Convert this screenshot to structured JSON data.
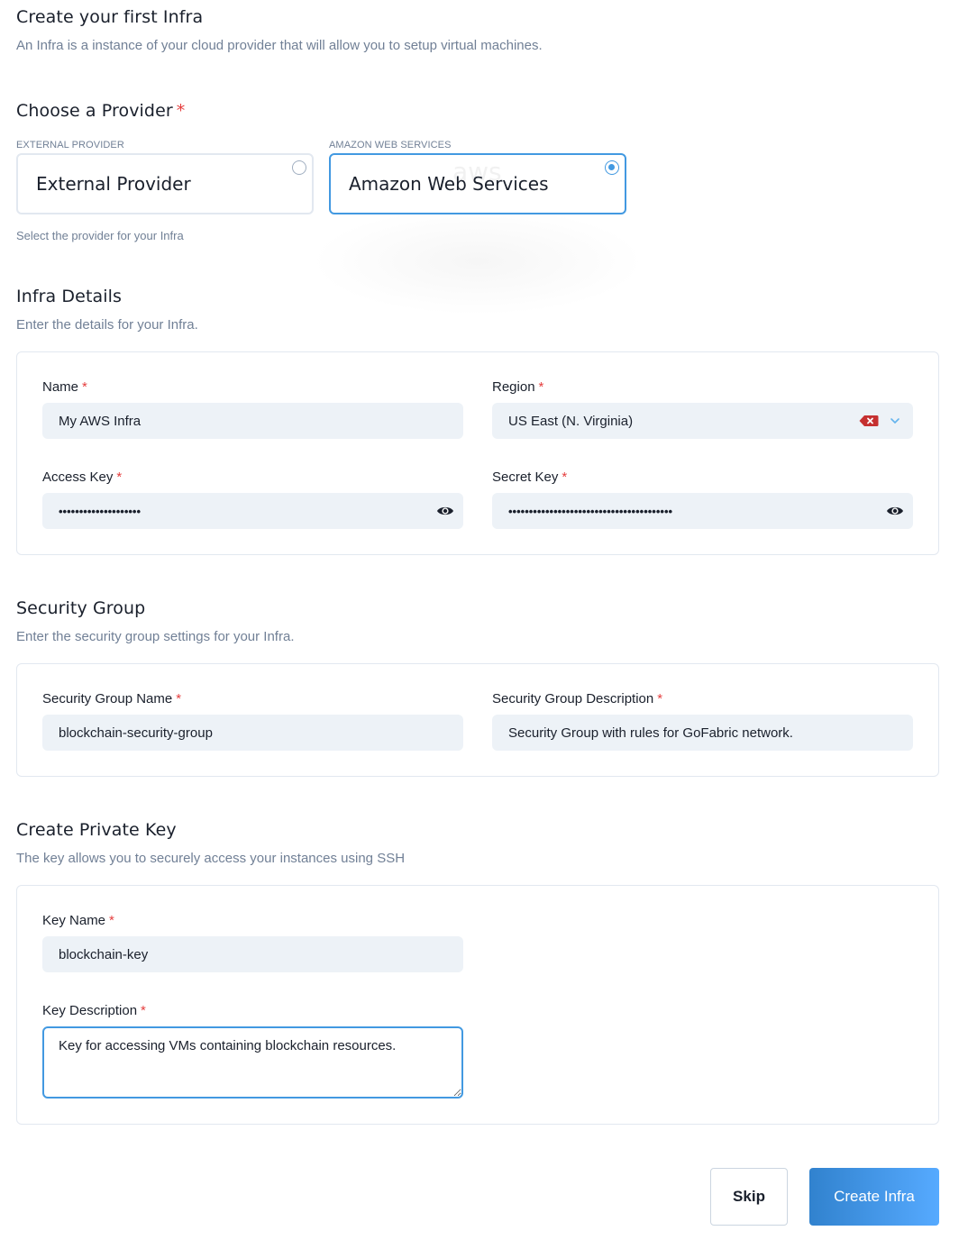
{
  "header": {
    "title": "Create your first Infra",
    "subtitle": "An Infra is a instance of your cloud provider that will allow you to setup virtual machines."
  },
  "provider": {
    "title": "Choose a Provider",
    "required_mark": "*",
    "help": "Select the provider for your Infra",
    "options": [
      {
        "caption": "EXTERNAL PROVIDER",
        "name": "External Provider",
        "selected": false
      },
      {
        "caption": "AMAZON WEB SERVICES",
        "name": "Amazon Web Services",
        "selected": true,
        "watermark": "aws"
      }
    ]
  },
  "infra_details": {
    "title": "Infra Details",
    "subtitle": "Enter the details for your Infra.",
    "fields": {
      "name": {
        "label": "Name",
        "value": "My AWS Infra"
      },
      "region": {
        "label": "Region",
        "value": "US East (N. Virginia)",
        "clear_icon": "clear-icon",
        "dropdown_icon": "chevron-down-icon"
      },
      "access_key": {
        "label": "Access Key",
        "value": "••••••••••••••••••••",
        "toggle_icon": "eye-icon"
      },
      "secret_key": {
        "label": "Secret Key",
        "value": "••••••••••••••••••••••••••••••••••••••••",
        "toggle_icon": "eye-icon"
      }
    }
  },
  "security_group": {
    "title": "Security Group",
    "subtitle": "Enter the security group settings for your Infra.",
    "fields": {
      "name": {
        "label": "Security Group Name",
        "value": "blockchain-security-group"
      },
      "description": {
        "label": "Security Group Description",
        "value": "Security Group with rules for GoFabric network."
      }
    }
  },
  "private_key": {
    "title": "Create Private Key",
    "subtitle": "The key allows you to securely access your instances using SSH",
    "fields": {
      "name": {
        "label": "Key Name",
        "value": "blockchain-key"
      },
      "description": {
        "label": "Key Description",
        "value": "Key for accessing VMs containing blockchain resources."
      }
    }
  },
  "actions": {
    "skip": "Skip",
    "create": "Create Infra"
  },
  "colors": {
    "accent": "#4299e1",
    "required": "#e53e3e",
    "input_bg": "#edf2f7",
    "clear_icon": "#c53030",
    "button_gradient_start": "#3182ce",
    "button_gradient_end": "#56aaff"
  }
}
